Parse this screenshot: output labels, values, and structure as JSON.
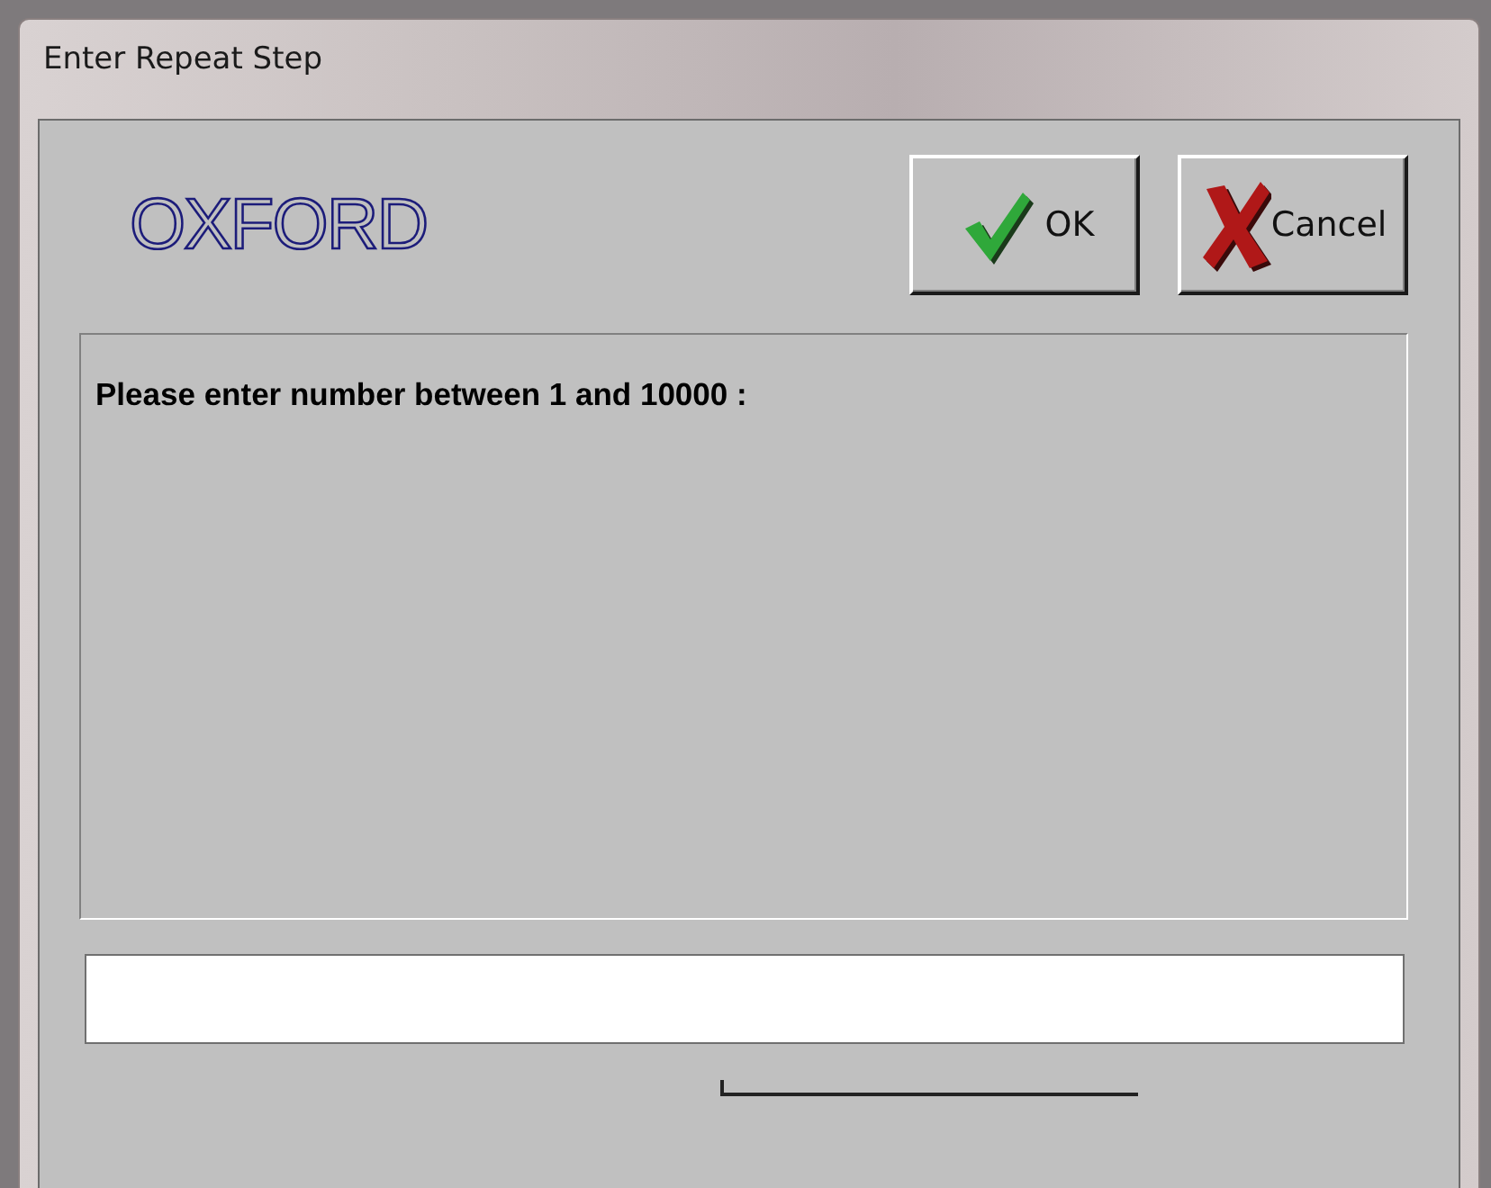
{
  "window": {
    "title": "Enter Repeat Step"
  },
  "logo": {
    "text": "OXFORD"
  },
  "buttons": [
    {
      "kind": "ok",
      "label": "OK"
    },
    {
      "kind": "cancel",
      "label": "Cancel"
    }
  ],
  "prompt": "Please enter number between 1 and 10000 :"
}
